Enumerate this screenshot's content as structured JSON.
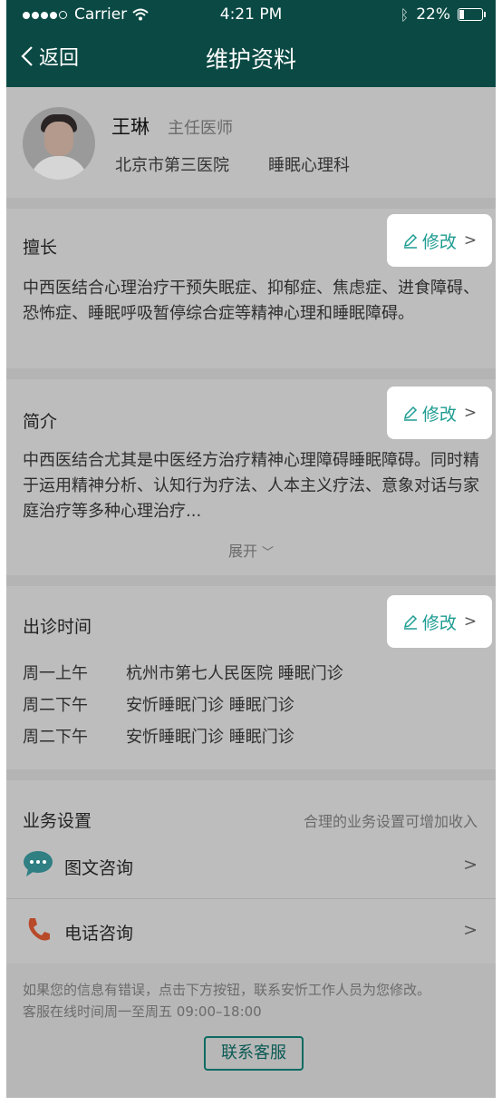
{
  "status_bar": {
    "carrier": "Carrier",
    "time": "4:21 PM",
    "battery": "22%"
  },
  "nav": {
    "back_label": "返回",
    "title": "维护资料"
  },
  "profile": {
    "name": "王琳",
    "rank": "主任医师",
    "hospital": "北京市第三医院",
    "department": "睡眠心理科"
  },
  "specialty": {
    "heading": "擅长",
    "edit_label": "修改",
    "text": "中西医结合心理治疗干预失眠症、抑郁症、焦虑症、进食障碍、恐怖症、睡眠呼吸暂停综合症等精神心理和睡眠障碍。"
  },
  "intro": {
    "heading": "简介",
    "edit_label": "修改",
    "text": "中西医结合尤其是中医经方治疗精神心理障碍睡眠障碍。同时精于运用精神分析、认知行为疗法、人本主义疗法、意象对话与家庭治疗等多种心理治疗...",
    "expand_label": "展开"
  },
  "schedule": {
    "heading": "出诊时间",
    "edit_label": "修改",
    "rows": [
      {
        "day": "周一上午",
        "place": "杭州市第七人民医院  睡眠门诊"
      },
      {
        "day": "周二下午",
        "place": "安忻睡眠门诊  睡眠门诊"
      },
      {
        "day": "周二下午",
        "place": "安忻睡眠门诊  睡眠门诊"
      }
    ]
  },
  "business": {
    "heading": "业务设置",
    "hint": "合理的业务设置可增加收入",
    "items": [
      {
        "label": "图文咨询",
        "icon": "chat-bubble-icon"
      },
      {
        "label": "电话咨询",
        "icon": "phone-icon"
      }
    ]
  },
  "footer": {
    "note1": "如果您的信息有错误，点击下方按钮，联系安忻工作人员为您修改。",
    "note2": "客服在线时间周一至周五  09:00–18:00",
    "contact_label": "联系客服"
  }
}
